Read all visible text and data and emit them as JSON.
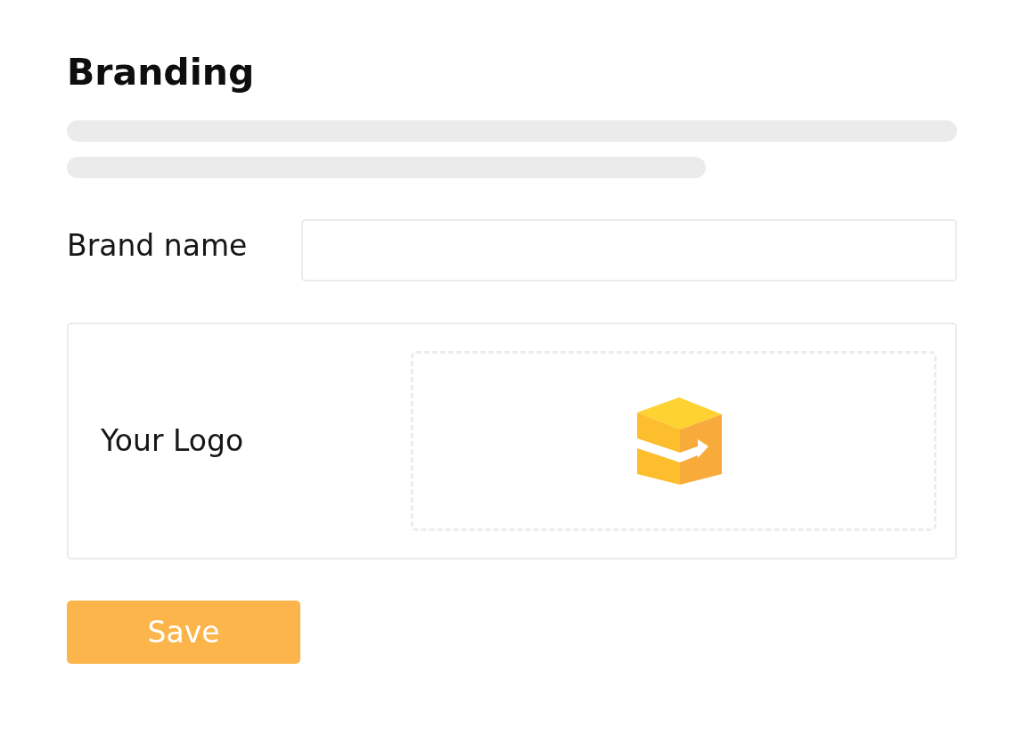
{
  "page": {
    "title": "Branding"
  },
  "brand_name": {
    "label": "Brand name"
  },
  "logo": {
    "label": "Your Logo"
  },
  "buttons": [
    {
      "label": "Save"
    }
  ]
}
